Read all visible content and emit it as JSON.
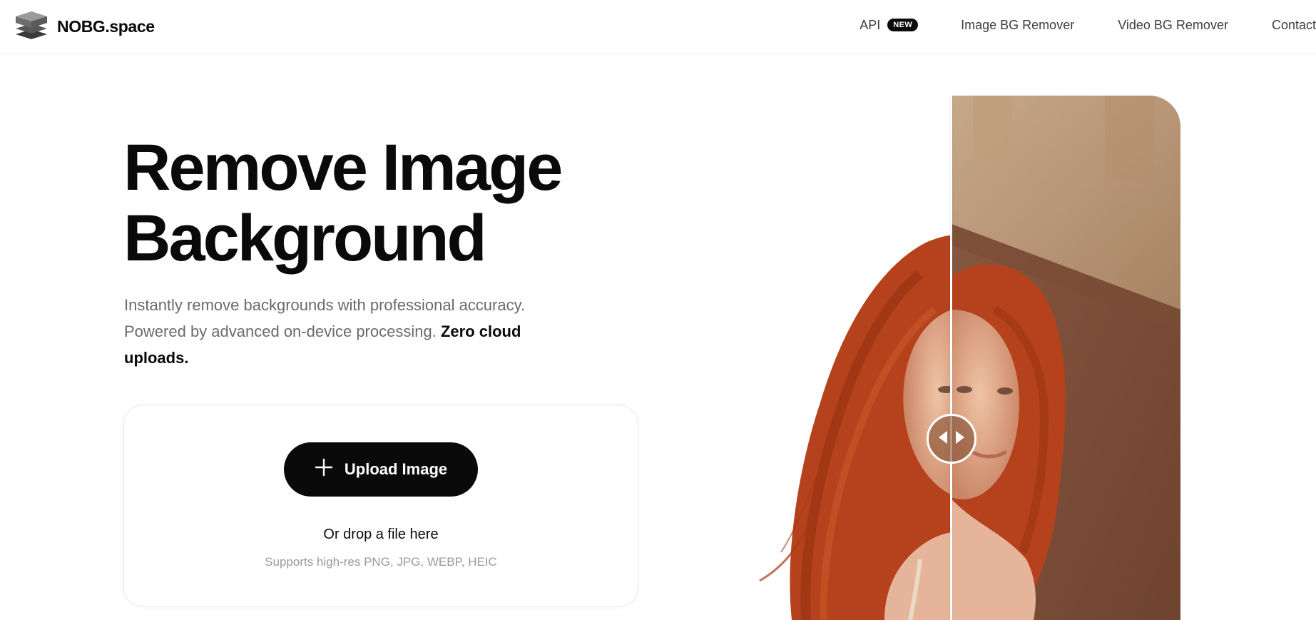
{
  "brand": {
    "name": "NOBG.space",
    "logo_icon": "stacked-layers-icon"
  },
  "nav": {
    "api": {
      "label": "API",
      "badge": "NEW"
    },
    "image_bg_remover": "Image BG Remover",
    "video_bg_remover": "Video BG Remover",
    "contact": "Contact"
  },
  "hero": {
    "title_line1": "Remove Image",
    "title_line2": "Background",
    "description": "Instantly remove backgrounds with professional accuracy. Powered by advanced on-device processing.",
    "description_emphasis": "Zero cloud uploads."
  },
  "upload": {
    "button_label": "Upload Image",
    "button_icon": "plus-icon",
    "drop_text": "Or drop a file here",
    "supports_text": "Supports high-res PNG, JPG, WEBP, HEIC"
  },
  "compare": {
    "handle_icon": "left-right-arrows-icon",
    "colors": {
      "wall": "#8a5a42",
      "hair": "#b5421c",
      "skin": "#e6b49a"
    }
  },
  "colors": {
    "accent": "#0a0a0a",
    "muted_text": "#6a6a6a",
    "border": "#e8e8e8"
  }
}
